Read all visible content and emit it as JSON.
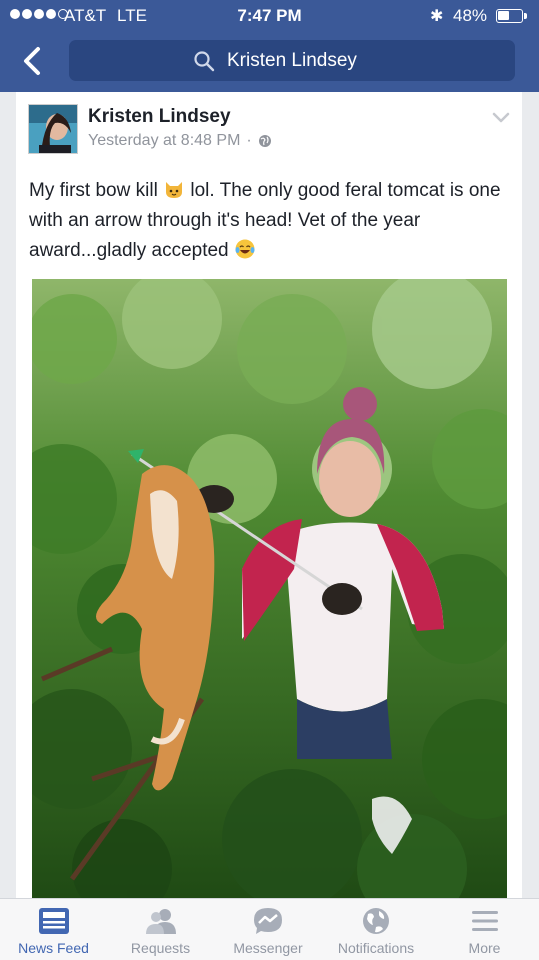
{
  "status_bar": {
    "carrier": "AT&T",
    "network": "LTE",
    "time": "7:47 PM",
    "battery_percent": "48%",
    "battery_level": 0.48
  },
  "header": {
    "search_text": "Kristen Lindsey",
    "back_icon": "chevron-left-icon",
    "search_icon": "magnifier-icon"
  },
  "post": {
    "author": "Kristen Lindsey",
    "timestamp": "Yesterday at 8:48 PM",
    "separator": "·",
    "privacy_icon": "globe-icon",
    "text_part1": "My first bow kill",
    "text_part2": "lol. The only good feral tomcat is one with an arrow through it's head! Vet of the year award...gladly accepted",
    "emoji1": "cat-face-emoji",
    "emoji2": "tears-of-joy-emoji"
  },
  "tabbar": {
    "tabs": [
      {
        "label": "News Feed",
        "icon": "news-feed-icon",
        "active": true
      },
      {
        "label": "Requests",
        "icon": "requests-icon",
        "active": false
      },
      {
        "label": "Messenger",
        "icon": "messenger-icon",
        "active": false
      },
      {
        "label": "Notifications",
        "icon": "notifications-icon",
        "active": false
      },
      {
        "label": "More",
        "icon": "more-icon",
        "active": false
      }
    ]
  },
  "colors": {
    "brand_blue": "#3b5998",
    "search_bg": "#2a4680",
    "active_tab": "#4267b2",
    "inactive_tab": "#9197a3",
    "meta_gray": "#90949c"
  }
}
